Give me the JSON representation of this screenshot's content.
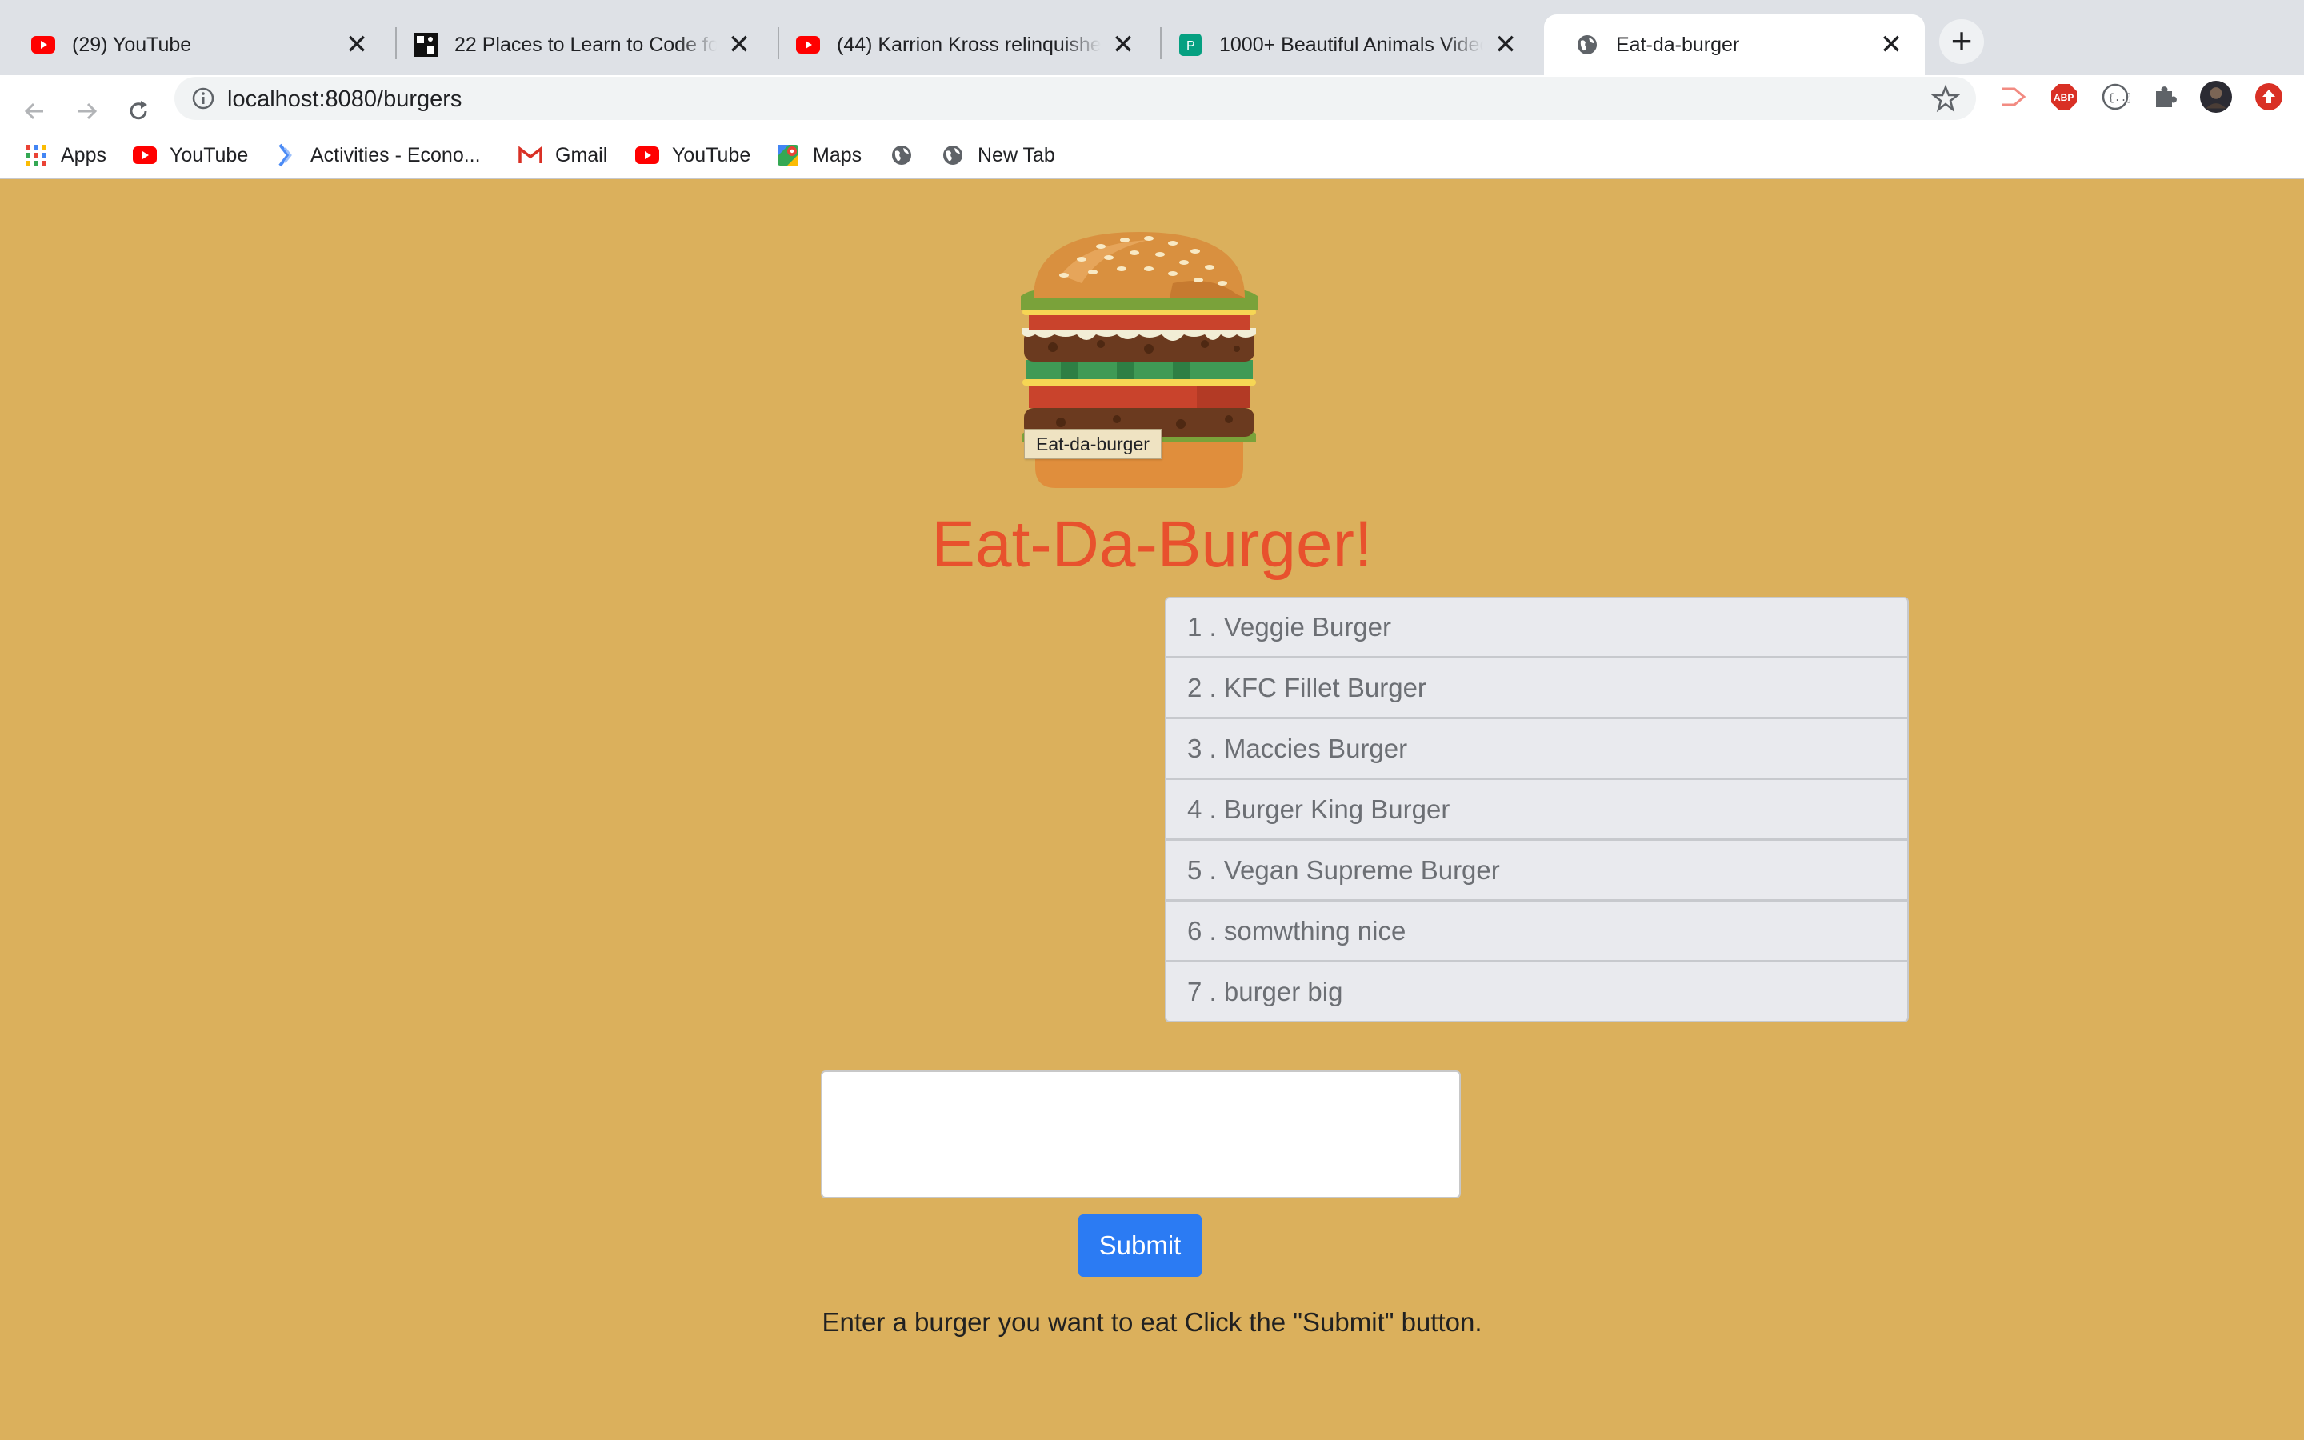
{
  "browser": {
    "tabs": [
      {
        "title": "(29) YouTube",
        "icon": "youtube-icon",
        "active": false
      },
      {
        "title": "22 Places to Learn to Code for Free",
        "icon": "freecodecamp-icon",
        "active": false
      },
      {
        "title": "(44) Karrion Kross relinquishes",
        "icon": "youtube-icon",
        "active": false
      },
      {
        "title": "1000+ Beautiful Animals Videos",
        "icon": "pexels-icon",
        "active": false
      },
      {
        "title": "Eat-da-burger",
        "icon": "globe-icon",
        "active": true
      }
    ],
    "new_tab_label": "+",
    "close_glyph": "✕",
    "url": "localhost:8080/burgers",
    "bookmarks": [
      {
        "label": "Apps",
        "icon": "apps-grid-icon"
      },
      {
        "label": "YouTube",
        "icon": "youtube-icon"
      },
      {
        "label": "Activities - Econo...",
        "icon": "bookmark-activities-icon"
      },
      {
        "label": "Gmail",
        "icon": "gmail-icon"
      },
      {
        "label": "YouTube",
        "icon": "youtube-icon"
      },
      {
        "label": "Maps",
        "icon": "maps-icon"
      },
      {
        "label": "",
        "icon": "globe-icon"
      },
      {
        "label": "New Tab",
        "icon": "globe-icon"
      }
    ]
  },
  "page": {
    "logo_tooltip": "Eat-da-burger",
    "heading": "Eat-Da-Burger!",
    "burgers": [
      "1 . Veggie Burger",
      "2 . KFC Fillet Burger",
      "3 . Maccies Burger",
      "4 . Burger King Burger",
      "5 . Vegan Supreme Burger",
      "6 . somwthing nice",
      "7 . burger big"
    ],
    "input_value": "",
    "submit_label": "Submit",
    "instructions": "Enter a burger you want to eat Click the \"Submit\" button."
  },
  "colors": {
    "page_background": "#dbb05c",
    "heading": "#e8512d",
    "submit_button": "#2b7bf3",
    "list_item_bg": "#e9eaee"
  }
}
